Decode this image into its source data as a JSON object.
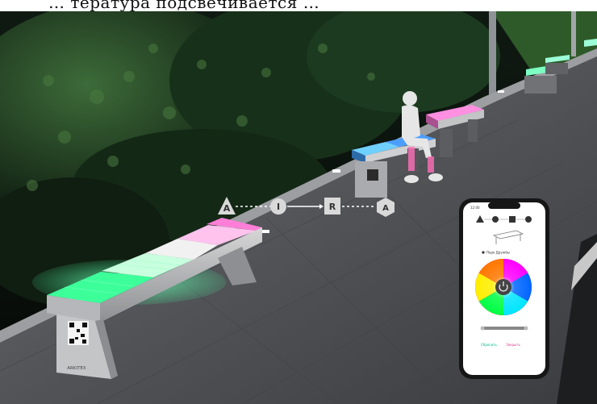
{
  "caption_text": "… тература подсвечивается …",
  "diagram": {
    "labels": [
      "A",
      "I",
      "R",
      "A"
    ]
  },
  "bench_brand": "ARKITEX",
  "phone": {
    "status_time": "12:00",
    "location": "Парк Дружбы",
    "buttons": {
      "left": "Сбросить",
      "right": "Закрыть"
    }
  },
  "colors": {
    "bench_green": "#3dff9a",
    "bench_white": "#ffffff",
    "bench_pink": "#ff7fd8",
    "bench_blue": "#4fb4ff",
    "sidewalk": "#5a5c60",
    "foliage": "#1f3a22"
  }
}
